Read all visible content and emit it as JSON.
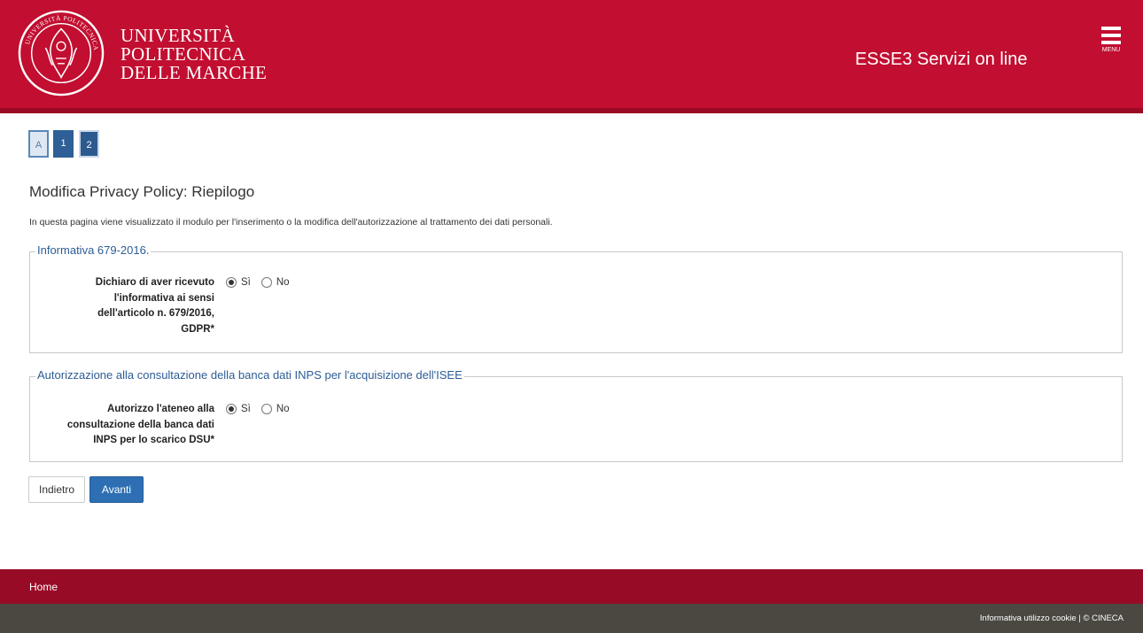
{
  "header": {
    "university_lines": [
      "UNIVERSITÀ",
      "POLITECNICA",
      "DELLE MARCHE"
    ],
    "logo_text": "UNIVERSITÀ POLITECNICA DELLE MARCHE",
    "portal_title": "ESSE3 Servizi on line",
    "menu_label": "MENU",
    "logo_icon": "university-seal-icon",
    "menu_icon": "hamburger-menu-icon"
  },
  "steps": [
    {
      "label": "A",
      "state": "current"
    },
    {
      "label": "1",
      "state": "done"
    },
    {
      "label": "2",
      "state": "done"
    }
  ],
  "page": {
    "title": "Modifica Privacy Policy: Riepilogo",
    "description": "In questa pagina viene visualizzato il modulo per l'inserimento o la modifica dell'autorizzazione al trattamento dei dati personali."
  },
  "sections": [
    {
      "legend": "Informativa 679-2016.",
      "field_label_lines": [
        "Dichiaro di aver ricevuto",
        "l'informativa ai sensi",
        "dell'articolo n. 679/2016,",
        "GDPR*"
      ],
      "options": [
        "Sì",
        "No"
      ],
      "selected": "Sì"
    },
    {
      "legend": "Autorizzazione alla consultazione della banca dati INPS per l'acquisizione dell'ISEE",
      "field_label_lines": [
        "Autorizzo l'ateneo alla",
        "consultazione della banca dati",
        "INPS per lo scarico DSU*"
      ],
      "options": [
        "Sì",
        "No"
      ],
      "selected": "Sì"
    }
  ],
  "buttons": {
    "back": "Indietro",
    "next": "Avanti"
  },
  "footer": {
    "home": "Home",
    "cookie_link": "Informativa utilizzo cookie",
    "separator": " | ",
    "copyright": "© CINECA"
  },
  "colors": {
    "header_red": "#c20e30",
    "footer_red": "#980b26",
    "footer_gray": "#4b4842",
    "accent_blue": "#2e6fb3"
  }
}
